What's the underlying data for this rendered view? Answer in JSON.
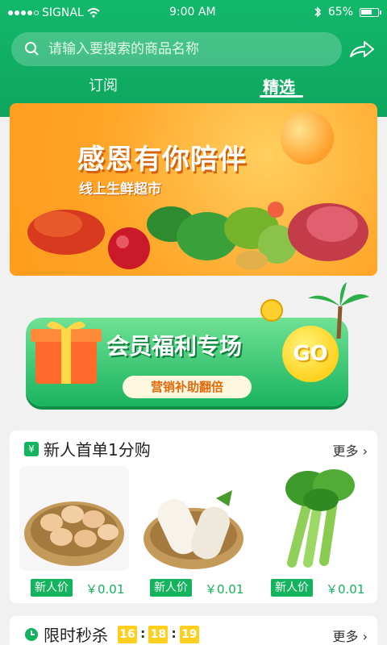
{
  "status": {
    "carrier": "SIGNAL",
    "time": "9:00 AM",
    "battery": "65%",
    "battery_fill": 0.65
  },
  "search": {
    "placeholder": "请输入要搜索的商品名称"
  },
  "tabs": [
    {
      "label": "订阅"
    },
    {
      "label": "精选"
    }
  ],
  "banner": {
    "title": "感恩有你陪伴",
    "subtitle": "线上生鲜超市"
  },
  "member": {
    "title": "会员福利专场",
    "subtitle": "营销补助翻倍",
    "go": "GO"
  },
  "newcomer": {
    "title": "新人首单1分购",
    "more": "更多",
    "products": [
      {
        "name": "eggs",
        "tag": "新人价",
        "price": "￥0.01"
      },
      {
        "name": "radish",
        "tag": "新人价",
        "price": "￥0.01"
      },
      {
        "name": "celery",
        "tag": "新人价",
        "price": "￥0.01"
      }
    ]
  },
  "flash": {
    "title": "限时秒杀",
    "more": "更多",
    "timer": [
      "16",
      "18",
      "19"
    ]
  },
  "colors": {
    "brand": "#14b35d",
    "accent": "#ff9f1c",
    "timer": "#ffcf1f"
  }
}
